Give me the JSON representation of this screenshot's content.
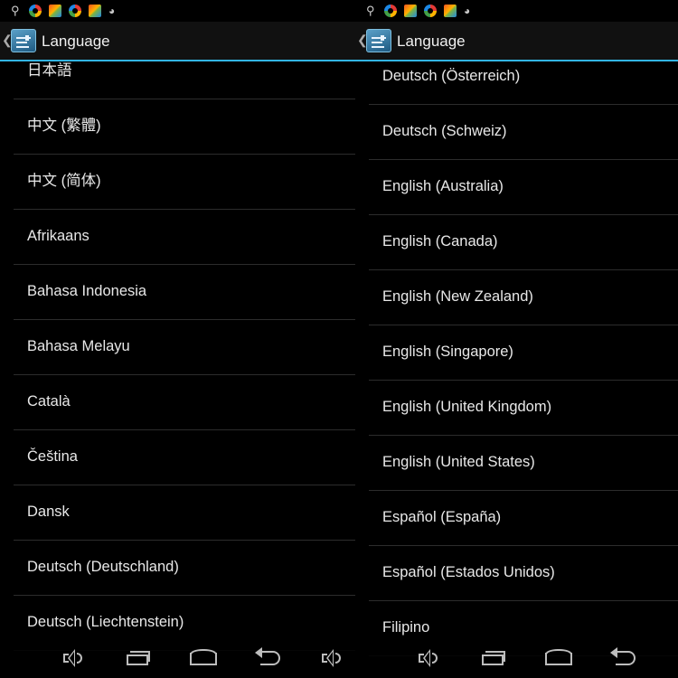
{
  "left": {
    "title": "Language",
    "items": [
      "日本語",
      "中文 (繁體)",
      "中文 (简体)",
      "Afrikaans",
      "Bahasa Indonesia",
      "Bahasa Melayu",
      "Català",
      "Čeština",
      "Dansk",
      "Deutsch (Deutschland)",
      "Deutsch (Liechtenstein)"
    ]
  },
  "right": {
    "title": "Language",
    "items": [
      "Deutsch (Österreich)",
      "Deutsch (Schweiz)",
      "English (Australia)",
      "English (Canada)",
      "English (New Zealand)",
      "English (Singapore)",
      "English (United Kingdom)",
      "English (United States)",
      "Español (España)",
      "Español (Estados Unidos)",
      "Filipino"
    ]
  },
  "status_icons": [
    "usb-icon",
    "chrome-icon",
    "gallery-icon",
    "chrome-icon",
    "gallery-icon",
    "android-icon"
  ],
  "nav_icons": [
    "volume-down-icon",
    "recent-apps-icon",
    "home-icon",
    "back-icon",
    "volume-up-icon"
  ],
  "colors": {
    "accent": "#33b5e5",
    "background": "#000000",
    "divider": "#2c2c2c"
  }
}
